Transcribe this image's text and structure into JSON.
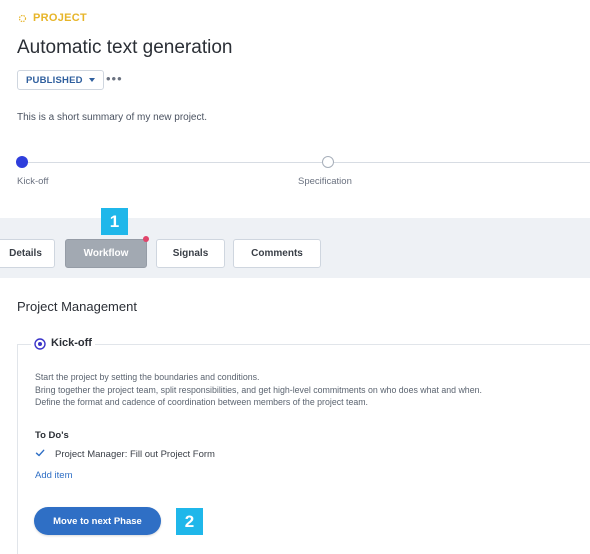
{
  "header": {
    "project_tag": "PROJECT",
    "title": "Automatic text generation",
    "status": "PUBLISHED",
    "more": "•••",
    "summary": "This is a short summary of my new project."
  },
  "phases": [
    {
      "label": "Kick-off",
      "active": true
    },
    {
      "label": "Specification",
      "active": false
    }
  ],
  "tabs": [
    {
      "label": "Details",
      "active": false
    },
    {
      "label": "Workflow",
      "active": true,
      "notification": true
    },
    {
      "label": "Signals",
      "active": false
    },
    {
      "label": "Comments",
      "active": false
    }
  ],
  "annotations": {
    "badge_1": "1",
    "badge_2": "2"
  },
  "content": {
    "section_title": "Project Management",
    "phase_card": {
      "title": "Kick-off",
      "description": [
        "Start the project by setting the boundaries and conditions.",
        "Bring together the project team, split responsibilities, and get high-level commitments on who does what and when.",
        "Define the format and cadence of coordination between members of the project team."
      ],
      "todos_heading": "To Do's",
      "todos": [
        {
          "text": "Project Manager: Fill out Project Form",
          "checked": true
        }
      ],
      "add_item": "Add item",
      "next_phase_button": "Move to next Phase"
    }
  },
  "colors": {
    "accent_blue": "#2f6fc5",
    "phase_active": "#2f3edc",
    "project_tag": "#e7b529",
    "badge": "#1fb7ea",
    "notification_dot": "#e0446a"
  }
}
